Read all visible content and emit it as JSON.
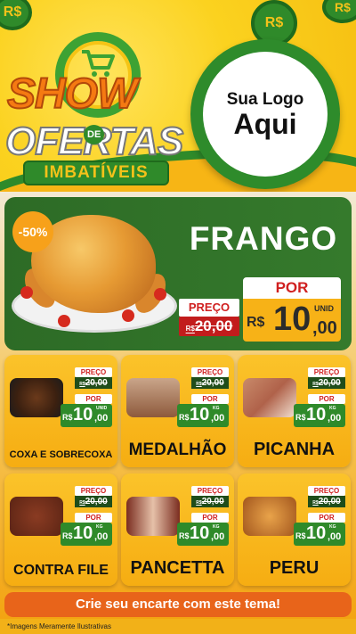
{
  "header": {
    "show": "SHOW",
    "de": "DE",
    "ofertas": "OFERTAS",
    "imbativeis": "IMBATÍVEIS",
    "coin_symbol": "R$",
    "logo_line1": "Sua Logo",
    "logo_line2": "Aqui"
  },
  "hero": {
    "discount": "-50%",
    "name": "FRANGO",
    "preco_label": "PREÇO",
    "old_currency": "R$",
    "old_price": "20,00",
    "por_label": "POR",
    "currency": "R$",
    "price_int": "10",
    "price_cents": ",00",
    "unit": "UNID"
  },
  "products": [
    {
      "name": "COXA E SOBRECOXA",
      "preco_label": "PREÇO",
      "old_currency": "R$",
      "old_price": "20,00",
      "por_label": "POR",
      "currency": "R$",
      "price_int": "10",
      "price_cents": ",00",
      "unit": "UNID"
    },
    {
      "name": "MEDALHÃO",
      "preco_label": "PREÇO",
      "old_currency": "R$",
      "old_price": "20,00",
      "por_label": "POR",
      "currency": "R$",
      "price_int": "10",
      "price_cents": ",00",
      "unit": "KG"
    },
    {
      "name": "PICANHA",
      "preco_label": "PREÇO",
      "old_currency": "R$",
      "old_price": "20,00",
      "por_label": "POR",
      "currency": "R$",
      "price_int": "10",
      "price_cents": ",00",
      "unit": "KG"
    },
    {
      "name": "CONTRA FILE",
      "preco_label": "PREÇO",
      "old_currency": "R$",
      "old_price": "20,00",
      "por_label": "POR",
      "currency": "R$",
      "price_int": "10",
      "price_cents": ",00",
      "unit": "KG"
    },
    {
      "name": "PANCETTA",
      "preco_label": "PREÇO",
      "old_currency": "R$",
      "old_price": "20,00",
      "por_label": "POR",
      "currency": "R$",
      "price_int": "10",
      "price_cents": ",00",
      "unit": "KG"
    },
    {
      "name": "PERU",
      "preco_label": "PREÇO",
      "old_currency": "R$",
      "old_price": "20,00",
      "por_label": "POR",
      "currency": "R$",
      "price_int": "10",
      "price_cents": ",00",
      "unit": "KG"
    }
  ],
  "cta": "Crie seu encarte com este tema!",
  "footer_note": "*Imagens Meramente Ilustrativas",
  "colors": {
    "green": "#2f8a2a",
    "yellow": "#f7b515",
    "orange": "#e8641a",
    "red": "#c21c1c"
  },
  "product_icons": [
    "chicken-thigh-pan-icon",
    "meat-skewers-icon",
    "picanha-board-icon",
    "steak-icon",
    "pancetta-icon",
    "roast-turkey-icon"
  ]
}
